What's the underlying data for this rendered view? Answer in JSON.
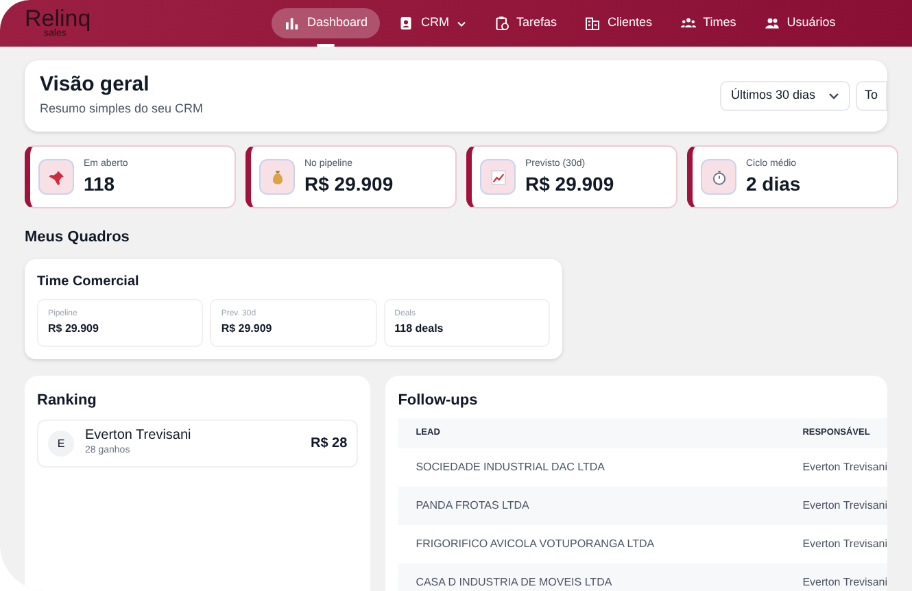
{
  "logo": {
    "name": "Relinq",
    "tagline": "sales"
  },
  "nav": [
    {
      "label": "Dashboard",
      "selected": true,
      "dropdown": false
    },
    {
      "label": "CRM",
      "selected": false,
      "dropdown": true
    },
    {
      "label": "Tarefas",
      "selected": false,
      "dropdown": false
    },
    {
      "label": "Clientes",
      "selected": false,
      "dropdown": false
    },
    {
      "label": "Times",
      "selected": false,
      "dropdown": false
    },
    {
      "label": "Usuários",
      "selected": false,
      "dropdown": false
    }
  ],
  "overview": {
    "title": "Visão geral",
    "subtitle": "Resumo simples do seu CRM",
    "period": "Últimos 30 dias",
    "second_filter": "To"
  },
  "kpis": [
    {
      "label": "Em aberto",
      "value": "118"
    },
    {
      "label": "No pipeline",
      "value": "R$ 29.909"
    },
    {
      "label": "Previsto (30d)",
      "value": "R$ 29.909"
    },
    {
      "label": "Ciclo médio",
      "value": "2 dias"
    }
  ],
  "boards": {
    "title": "Meus Quadros",
    "cards": [
      {
        "title": "Time Comercial",
        "stats": [
          {
            "label": "Pipeline",
            "value": "R$ 29.909"
          },
          {
            "label": "Prev. 30d",
            "value": "R$ 29.909"
          },
          {
            "label": "Deals",
            "value": "118 deals"
          }
        ]
      }
    ]
  },
  "ranking": {
    "title": "Ranking",
    "rows": [
      {
        "initial": "E",
        "name": "Everton Trevisani",
        "detail": "28 ganhos",
        "value": "R$ 28"
      }
    ]
  },
  "followups": {
    "title": "Follow-ups",
    "columns": [
      "LEAD",
      "RESPONSÁVEL"
    ],
    "rows": [
      [
        "SOCIEDADE INDUSTRIAL DAC LTDA",
        "Everton Trevisani"
      ],
      [
        "PANDA FROTAS LTDA",
        "Everton Trevisani"
      ],
      [
        "FRIGORIFICO AVICOLA VOTUPORANGA LTDA",
        "Everton Trevisani"
      ],
      [
        "CASA D INDUSTRIA DE MOVEIS LTDA",
        "Everton Trevisani"
      ]
    ]
  }
}
